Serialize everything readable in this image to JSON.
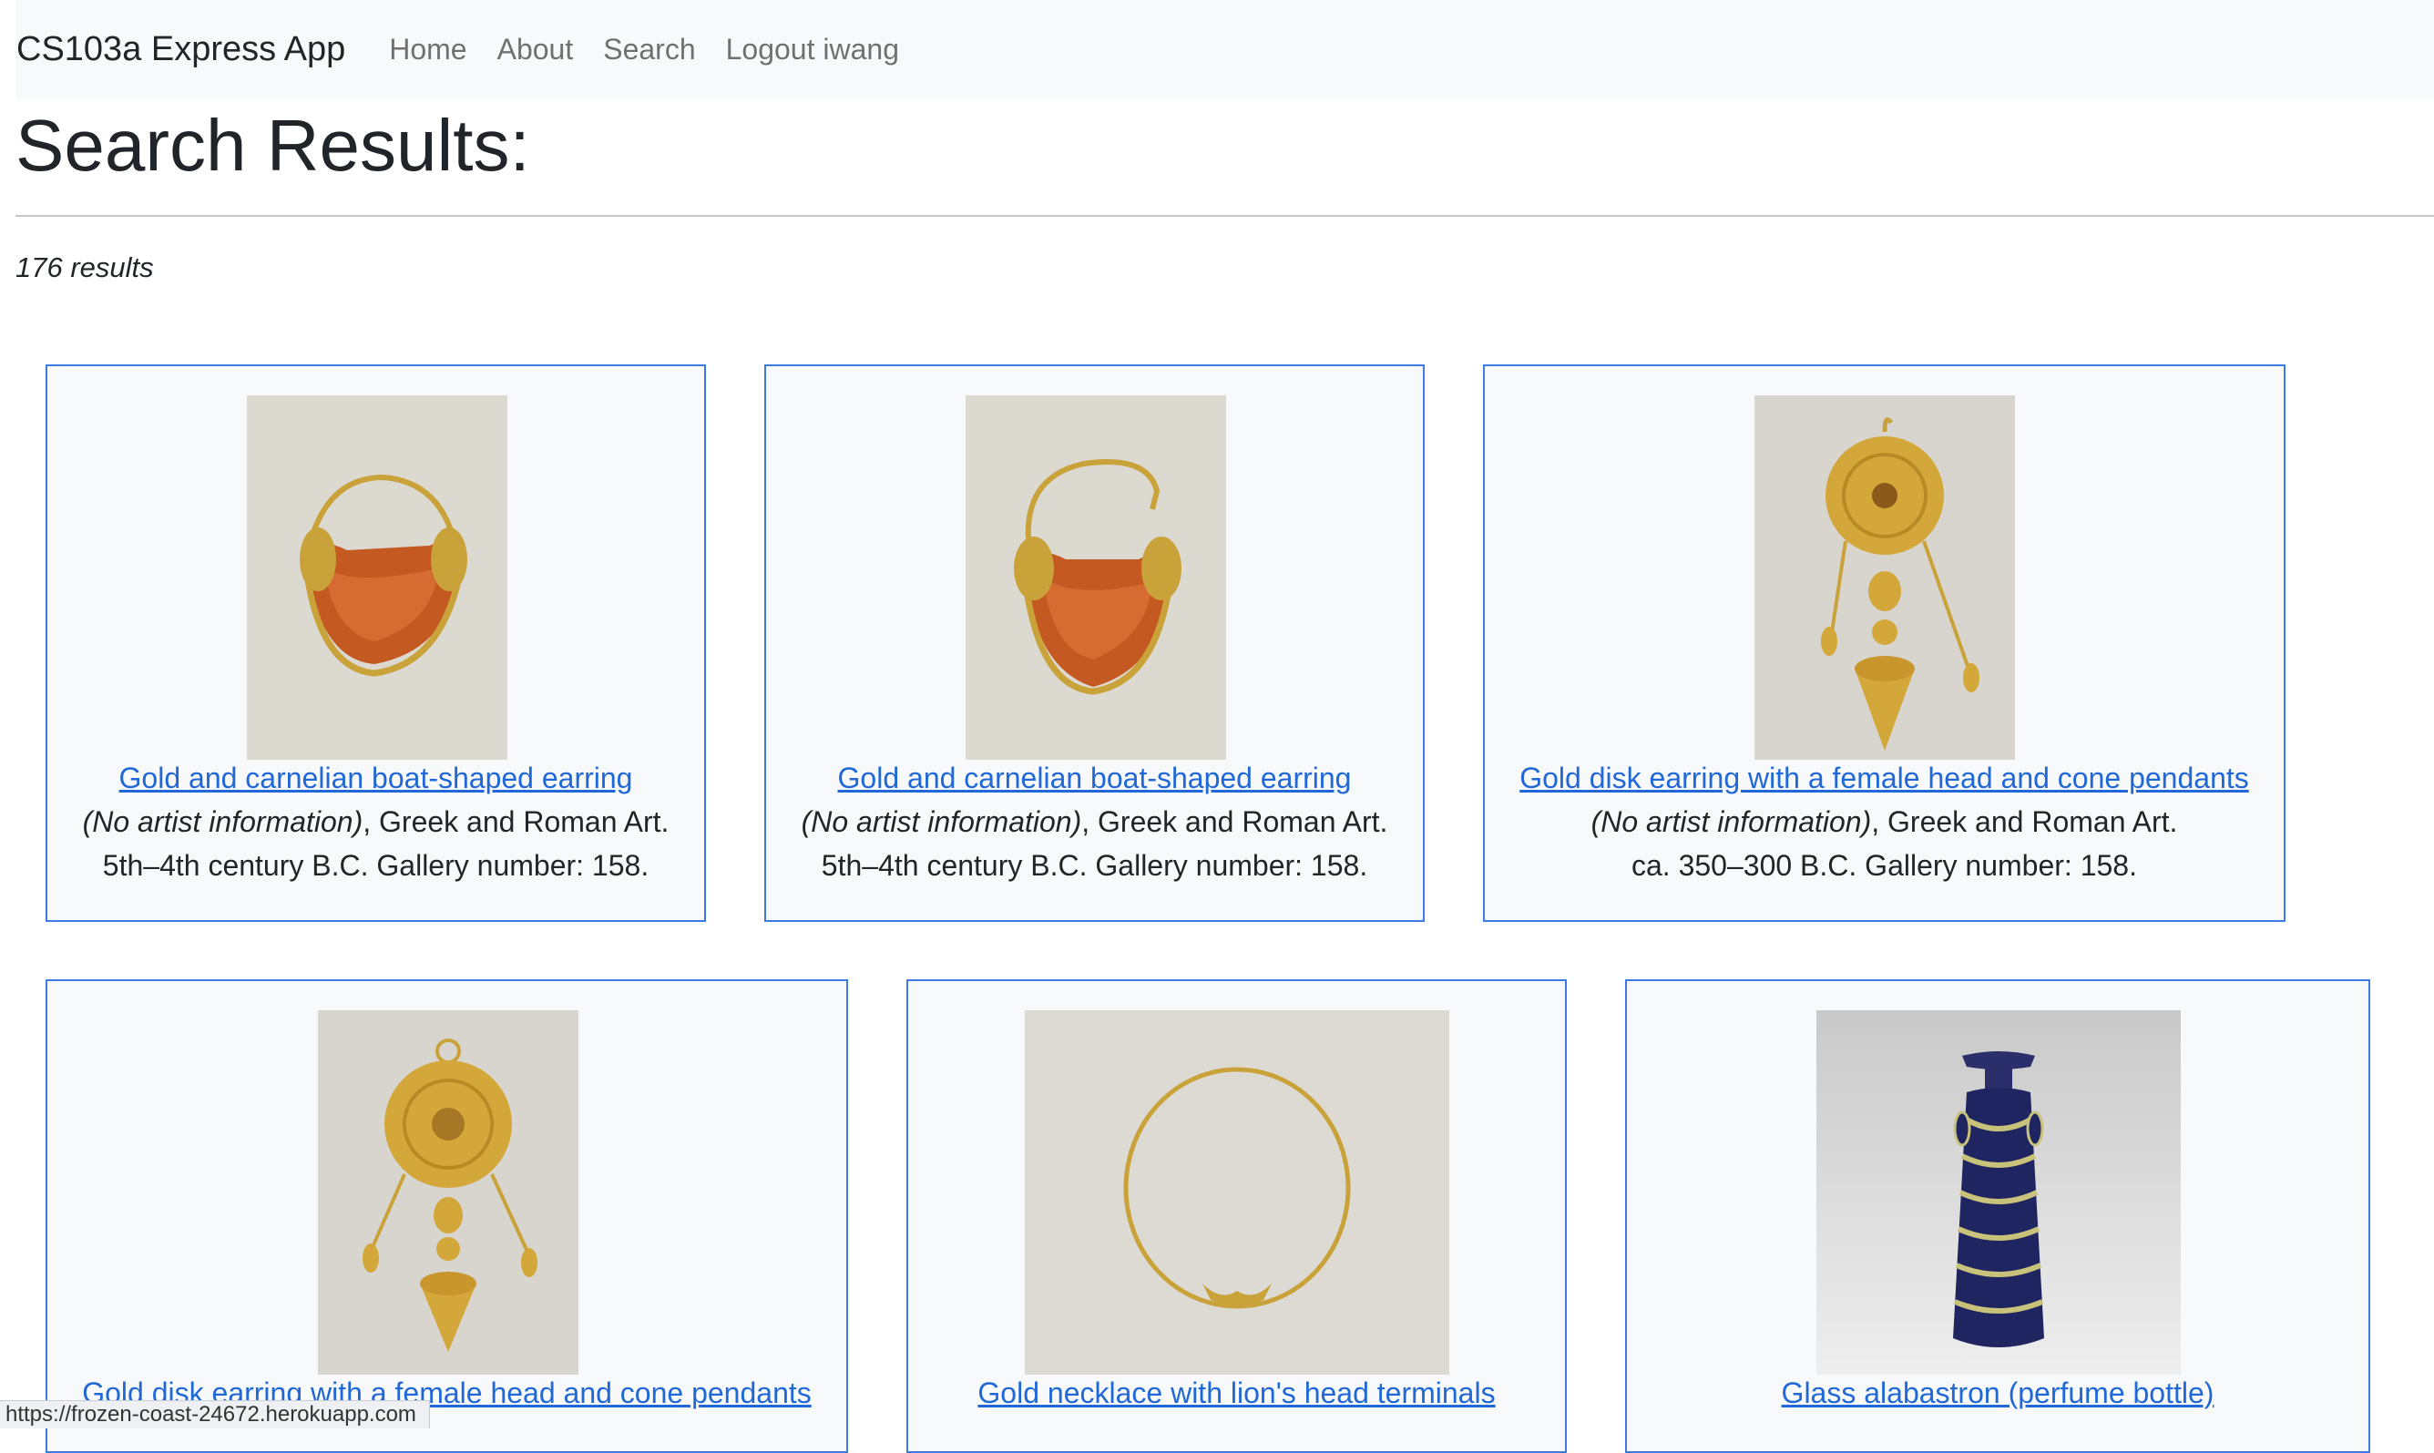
{
  "navbar": {
    "brand": "CS103a Express App",
    "links": [
      "Home",
      "About",
      "Search",
      "Logout iwang"
    ]
  },
  "page": {
    "title": "Search Results:",
    "result_count": "176 results"
  },
  "results": [
    {
      "title": "Gold and carnelian boat-shaped earring",
      "artist": "(No artist information)",
      "department": ", Greek and Roman Art.",
      "date_gallery": "5th–4th century B.C. Gallery number: 158.",
      "image_icon": "carnelian-earring-icon"
    },
    {
      "title": "Gold and carnelian boat-shaped earring",
      "artist": "(No artist information)",
      "department": ", Greek and Roman Art.",
      "date_gallery": "5th–4th century B.C. Gallery number: 158.",
      "image_icon": "carnelian-earring-icon"
    },
    {
      "title": "Gold disk earring with a female head and cone pendants",
      "artist": "(No artist information)",
      "department": ", Greek and Roman Art.",
      "date_gallery": "ca. 350–300 B.C. Gallery number: 158.",
      "image_icon": "disk-earring-icon"
    },
    {
      "title": "Gold disk earring with a female head and cone pendants",
      "image_icon": "disk-earring-icon"
    },
    {
      "title": "Gold necklace with lion's head terminals",
      "image_icon": "necklace-icon"
    },
    {
      "title": "Glass alabastron (perfume bottle)",
      "image_icon": "glass-bottle-icon"
    }
  ],
  "status_bar": {
    "url": "https://frozen-coast-24672.herokuapp.com"
  },
  "colors": {
    "link": "#2068d8",
    "card_border": "#3d7be0",
    "navbar_bg": "#f8f9fa"
  }
}
